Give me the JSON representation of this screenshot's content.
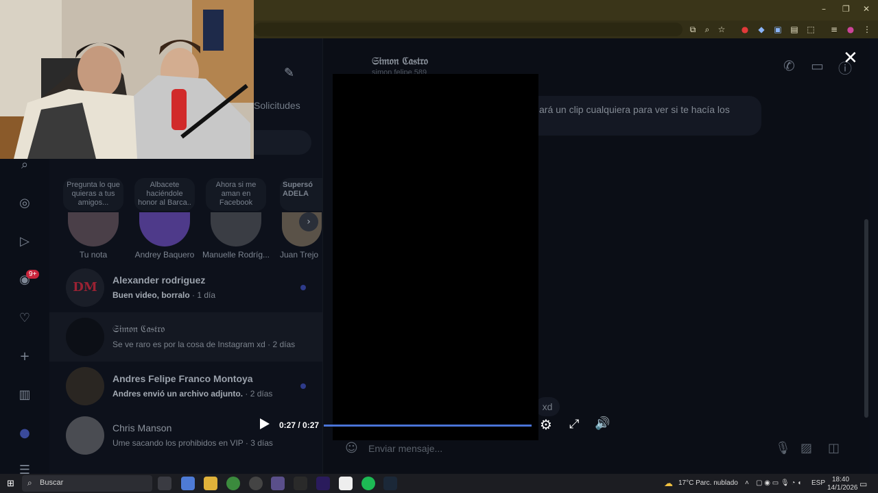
{
  "browser": {
    "window_controls": [
      "–",
      "❐",
      "✕"
    ],
    "toolbar_icons": [
      "install-icon",
      "zoom-icon",
      "star-icon",
      "adblock-icon",
      "extension-icon",
      "translate-icon",
      "extension-icon",
      "puzzle-icon",
      "playlist-icon",
      "profile-icon",
      "menu-icon"
    ]
  },
  "rail": {
    "notifications_badge": "9+"
  },
  "sidebar": {
    "requests_tab": "Solicitudes",
    "notes": [
      {
        "text": "Pregunta lo que quieras a tus amigos..."
      },
      {
        "text": "Albacete haciéndole honor al Barca.."
      },
      {
        "text": "Ahora si me aman en Facebook"
      },
      {
        "text": "Supersó ADELA"
      }
    ],
    "stories": [
      {
        "name": "Tu nota"
      },
      {
        "name": "Andrey Baquero"
      },
      {
        "name": "Manuelle Rodríg..."
      },
      {
        "name": "Juan Trejo"
      }
    ],
    "conversations": [
      {
        "name": "Alexander rodriguez",
        "preview": "Buen video, borralo",
        "time": "· 1 día"
      },
      {
        "name": "𝔖𝔦𝔪𝔬𝔫 ℭ𝔞𝔰𝔱𝔯𝔬",
        "preview": "Se ve raro es por la cosa de Instagram xd",
        "time": "· 2 días"
      },
      {
        "name": "Andres Felipe Franco Montoya",
        "preview": "Andres envió un archivo adjunto.",
        "time": "· 2 días"
      },
      {
        "name": "Chris Manson",
        "preview": "Ume sacando los prohibidos en VIP",
        "time": "· 3 días"
      }
    ]
  },
  "chat": {
    "contact_name": "𝔖𝔦𝔪𝔬𝔫 ℭ𝔞𝔰𝔱𝔯𝔬",
    "contact_sub": "simon.felipe.589",
    "message_text": "ará un clip cualquiera para ver si te hacía los",
    "reply_text": "xd",
    "composer_placeholder": "Enviar mensaje..."
  },
  "video": {
    "time": "0:27 / 0:27",
    "progress": 1.0
  },
  "taskbar": {
    "search_label": "Buscar",
    "weather": "17°C  Parc. nublado",
    "language": "ESP",
    "time": "18:40",
    "date": "14/1/2026"
  }
}
